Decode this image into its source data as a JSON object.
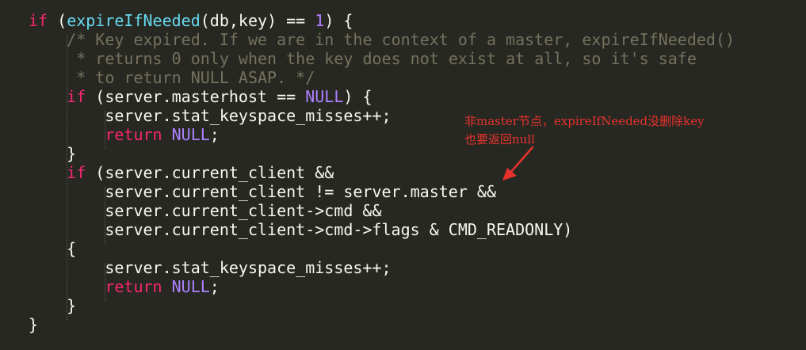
{
  "editor": {
    "theme": "dark",
    "colors": {
      "background": "#272822",
      "text": "#f8f8f2",
      "keyword": "#f92672",
      "function": "#66d9ef",
      "number_constant": "#ae81ff",
      "comment": "#75715e",
      "annotation": "#e8322d"
    },
    "lines": [
      [
        {
          "t": "if",
          "c": "kw"
        },
        {
          "t": " ("
        },
        {
          "t": "expireIfNeeded",
          "c": "fn"
        },
        {
          "t": "(db,key) == "
        },
        {
          "t": "1",
          "c": "num"
        },
        {
          "t": ") {"
        }
      ],
      [
        {
          "t": "    "
        },
        {
          "t": "/* Key expired. If we are in the context of a master, expireIfNeeded()",
          "c": "cm"
        }
      ],
      [
        {
          "t": "     "
        },
        {
          "t": "* returns 0 only when the key does not exist at all, so it's safe",
          "c": "cm"
        }
      ],
      [
        {
          "t": "     "
        },
        {
          "t": "* to return NULL ASAP. */",
          "c": "cm"
        }
      ],
      [
        {
          "t": "    "
        },
        {
          "t": "if",
          "c": "kw"
        },
        {
          "t": " (server.masterhost == "
        },
        {
          "t": "NULL",
          "c": "const"
        },
        {
          "t": ") {"
        }
      ],
      [
        {
          "t": "        server.stat_keyspace_misses++;"
        }
      ],
      [
        {
          "t": "        "
        },
        {
          "t": "return",
          "c": "kw"
        },
        {
          "t": " "
        },
        {
          "t": "NULL",
          "c": "const"
        },
        {
          "t": ";"
        }
      ],
      [
        {
          "t": "    }"
        }
      ],
      [
        {
          "t": "    "
        },
        {
          "t": "if",
          "c": "kw"
        },
        {
          "t": " (server.current_client &&"
        }
      ],
      [
        {
          "t": "        server.current_client != server.master &&"
        }
      ],
      [
        {
          "t": "        server.current_client->cmd &&"
        }
      ],
      [
        {
          "t": "        server.current_client->cmd->flags & CMD_READONLY)"
        }
      ],
      [
        {
          "t": "    {"
        }
      ],
      [
        {
          "t": "        server.stat_keyspace_misses++;"
        }
      ],
      [
        {
          "t": "        "
        },
        {
          "t": "return",
          "c": "kw"
        },
        {
          "t": " "
        },
        {
          "t": "NULL",
          "c": "const"
        },
        {
          "t": ";"
        }
      ],
      [
        {
          "t": "    }"
        }
      ],
      [
        {
          "t": "}"
        }
      ]
    ]
  },
  "annotation": {
    "line1": "非master节点，expireIfNeeded没删除key",
    "line2": "也要返回null",
    "arrow_icon": "red-arrow-icon"
  }
}
